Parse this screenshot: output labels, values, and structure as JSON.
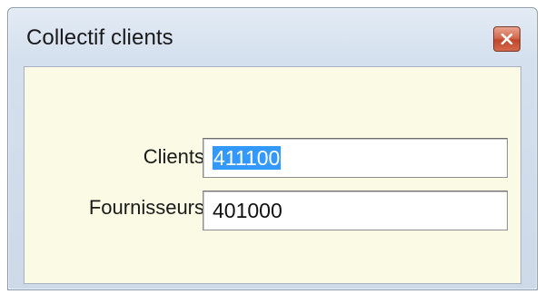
{
  "window": {
    "title": "Collectif clients"
  },
  "form": {
    "clients_label": "Clients",
    "clients_value": "411100",
    "fournisseurs_label": "Fournisseurs",
    "fournisseurs_value": "401000"
  },
  "icons": {
    "close": "close-icon"
  },
  "colors": {
    "client_area_bg": "#fbfbe5",
    "selection": "#3399ff",
    "close_button": "#c1472c"
  }
}
